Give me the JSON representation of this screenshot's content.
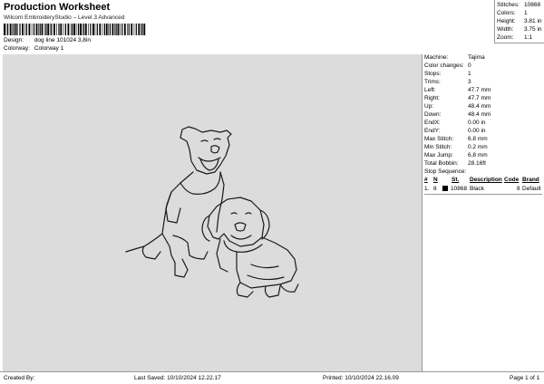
{
  "header": {
    "title": "Production Worksheet",
    "subtitle": "Wilcom EmbroideryStudio – Level 3 Advanced",
    "design_label": "Design:",
    "design_value": "dog line 101024 3,8in",
    "colorway_label": "Colorway:",
    "colorway_value": "Colorway 1"
  },
  "stats": [
    {
      "label": "Stitches:",
      "value": "10868"
    },
    {
      "label": "Colors:",
      "value": "1"
    },
    {
      "label": "Height:",
      "value": "3.81 in"
    },
    {
      "label": "Width:",
      "value": "3.75 in"
    },
    {
      "label": "Zoom:",
      "value": "1:1"
    }
  ],
  "machine_info": [
    {
      "label": "Machine:",
      "value": "Tajima"
    },
    {
      "label": "Color changes:",
      "value": "0"
    },
    {
      "label": "Stops:",
      "value": "1"
    },
    {
      "label": "Trims:",
      "value": "3"
    },
    {
      "label": "Left:",
      "value": "47.7 mm"
    },
    {
      "label": "Right:",
      "value": "47.7 mm"
    },
    {
      "label": "Up:",
      "value": "48.4 mm"
    },
    {
      "label": "Down:",
      "value": "48.4 mm"
    },
    {
      "label": "EndX:",
      "value": "0.00 in"
    },
    {
      "label": "EndY:",
      "value": "0.00 in"
    },
    {
      "label": "Max Stitch:",
      "value": "6.8 mm"
    },
    {
      "label": "Min Stitch:",
      "value": "0.2 mm"
    },
    {
      "label": "Max Jump:",
      "value": "6.8 mm"
    },
    {
      "label": "Total Bobbin:",
      "value": "28.16ft"
    }
  ],
  "stop_sequence": {
    "title": "Stop Sequence:",
    "headers": {
      "num": "#",
      "n": "N",
      "stitches": "St.",
      "description": "Description",
      "code": "Code",
      "brand": "Brand"
    },
    "rows": [
      {
        "num": "1.",
        "n": "8",
        "stitches": "10868",
        "description": "Black",
        "code": "8",
        "brand": "Default",
        "color": "#000000"
      }
    ]
  },
  "footer": {
    "created_by": "Created By:",
    "last_saved": "Last Saved: 10/10/2024 12.22.17",
    "printed": "Printed: 10/10/2024 22.16.09",
    "page": "Page 1 of 1"
  }
}
